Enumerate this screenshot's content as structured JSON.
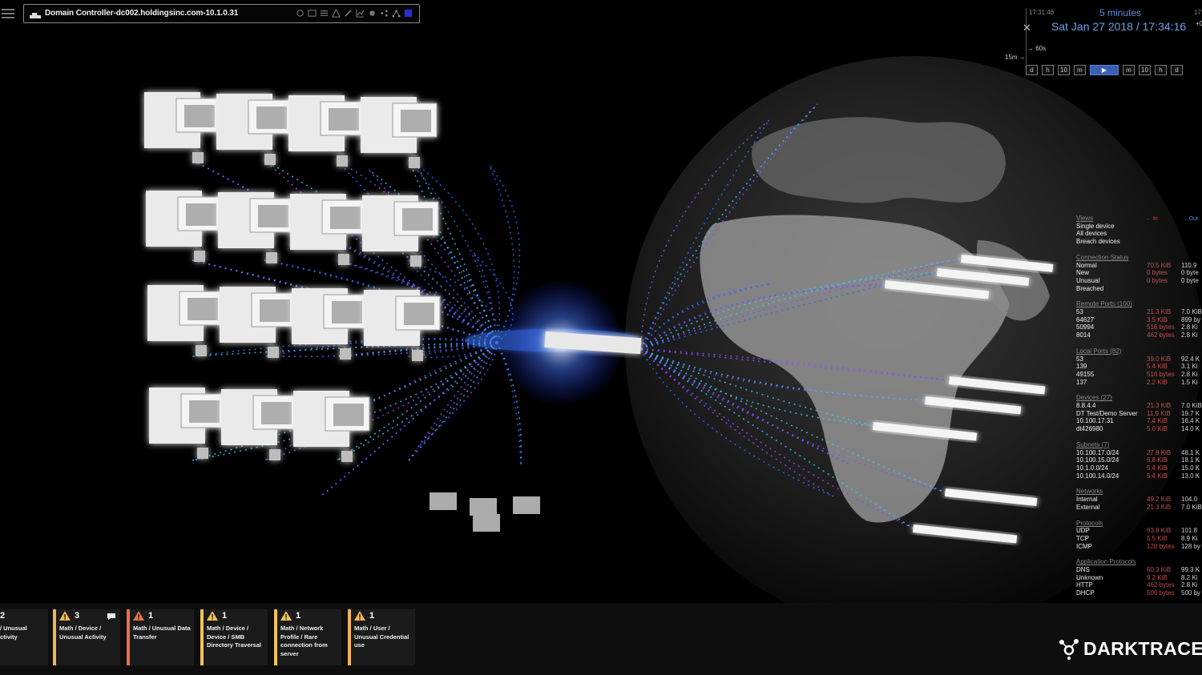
{
  "search": {
    "device_label": "Domain Controller-dc002.holdingsinc.com-10.1.0.31"
  },
  "toolbar": {
    "icons": [
      "filter-icon",
      "image-icon",
      "list-icon",
      "warning-icon",
      "edit-icon",
      "chart-icon",
      "gear-icon",
      "share-icon",
      "network-icon",
      "color-square-icon"
    ]
  },
  "time": {
    "clock_left": "17:31:46",
    "clock_right": "17:",
    "window": "5 minutes",
    "current": "Sat Jan 27 2018 / 17:34:16",
    "offset": "+00",
    "scale_60s": "60s",
    "scale_15m": "15m",
    "controls": [
      "d",
      "h",
      "10",
      "m",
      "▶",
      "m",
      "10",
      "h",
      "d"
    ]
  },
  "panel": {
    "in_label": "In",
    "out_label": "Out",
    "views": {
      "header": "Views",
      "items": [
        "Single device",
        "All devices",
        "Breach devices"
      ]
    },
    "groups": [
      {
        "header": "Connection Status",
        "rows": [
          {
            "label": "Normal",
            "in": "70.5 KiB",
            "out": "110.9"
          },
          {
            "label": "New",
            "in": "0 bytes",
            "out": "0 byte"
          },
          {
            "label": "Unusual",
            "in": "0 bytes",
            "out": "0 byte"
          },
          {
            "label": "Breached",
            "in": "",
            "out": ""
          }
        ]
      },
      {
        "header": "Remote Ports (100)",
        "rows": [
          {
            "label": "53",
            "in": "21.3 KiB",
            "out": "7.0 KiB"
          },
          {
            "label": "64627",
            "in": "3.5 KiB",
            "out": "899 by"
          },
          {
            "label": "50994",
            "in": "516 bytes",
            "out": "2.8 Ki"
          },
          {
            "label": "8014",
            "in": "462 bytes",
            "out": "2.8 Ki"
          }
        ]
      },
      {
        "header": "Local Ports (82)",
        "rows": [
          {
            "label": "53",
            "in": "39.0 KiB",
            "out": "92.4 K"
          },
          {
            "label": "139",
            "in": "5.4 KiB",
            "out": "3.1 Ki"
          },
          {
            "label": "49155",
            "in": "516 bytes",
            "out": "2.8 Ki"
          },
          {
            "label": "137",
            "in": "2.2 KiB",
            "out": "1.5 Ki"
          }
        ]
      },
      {
        "header": "Devices (27)",
        "rows": [
          {
            "label": "8.8.4.4",
            "in": "21.3 KiB",
            "out": "7.0 KiB"
          },
          {
            "label": "DT Test/Demo Server",
            "in": "11.9 KiB",
            "out": "19.7 K"
          },
          {
            "label": "10.100.17.31",
            "in": "7.4 KiB",
            "out": "16.4 K"
          },
          {
            "label": "dt426980",
            "in": "5.0 KiB",
            "out": "14.0 K"
          }
        ]
      },
      {
        "header": "Subnets (7)",
        "rows": [
          {
            "label": "10.100.17.0/24",
            "in": "27.8 KiB",
            "out": "48.1 K"
          },
          {
            "label": "10.100.15.0/24",
            "in": "6.8 KiB",
            "out": "18.1 K"
          },
          {
            "label": "10.1.0.0/24",
            "in": "5.4 KiB",
            "out": "15.0 K"
          },
          {
            "label": "10.100.14.0/24",
            "in": "5.4 KiB",
            "out": "13.0 K"
          }
        ]
      },
      {
        "header": "Networks",
        "rows": [
          {
            "label": "Internal",
            "in": "49.2 KiB",
            "out": "104.0"
          },
          {
            "label": "External",
            "in": "21.3 KiB",
            "out": "7.0 KiB"
          }
        ]
      },
      {
        "header": "Protocols",
        "rows": [
          {
            "label": "UDP",
            "in": "63.8 KiB",
            "out": "101.8"
          },
          {
            "label": "TCP",
            "in": "5.5 KiB",
            "out": "8.9 Ki"
          },
          {
            "label": "ICMP",
            "in": "128 bytes",
            "out": "128 by"
          }
        ]
      },
      {
        "header": "Application Protocols",
        "rows": [
          {
            "label": "DNS",
            "in": "60.3 KiB",
            "out": "99.3 K"
          },
          {
            "label": "Unknown",
            "in": "9.2 KiB",
            "out": "8.2 Ki"
          },
          {
            "label": "HTTP",
            "in": "462 bytes",
            "out": "2.8 Ki"
          },
          {
            "label": "DHCP",
            "in": "500 bytes",
            "out": "500 by"
          }
        ]
      }
    ]
  },
  "breaches": [
    {
      "count": "2",
      "desc": "/ Unusual\nctivity",
      "severity_color": "#ffffff",
      "bar": false,
      "chat": false
    },
    {
      "count": "3",
      "desc": "Math / Device /\nUnusual Activity",
      "severity_color": "#f0b35a",
      "bar": true,
      "chat": true
    },
    {
      "count": "1",
      "desc": "Math / Unusual Data\nTransfer",
      "severity_color": "#e8724a",
      "bar": true,
      "chat": false
    },
    {
      "count": "1",
      "desc": "Math / Device /\nDevice / SMB\nDirectory Traversal",
      "severity_color": "#f2c35a",
      "bar": true,
      "chat": false
    },
    {
      "count": "1",
      "desc": "Math / Network\nProfile / Rare\nconnection from\nserver",
      "severity_color": "#f2c35a",
      "bar": true,
      "chat": false
    },
    {
      "count": "1",
      "desc": "Math / User /\nUnusual Credential\nuse",
      "severity_color": "#f0b35a",
      "bar": true,
      "chat": false
    }
  ],
  "brand": {
    "name": "DARKTRACE"
  },
  "colors": {
    "accent_blue": "#5f8fd8",
    "in_red": "#c0504d",
    "flow_blue": "#2f6bff",
    "flow_violet": "#8a4dff"
  }
}
